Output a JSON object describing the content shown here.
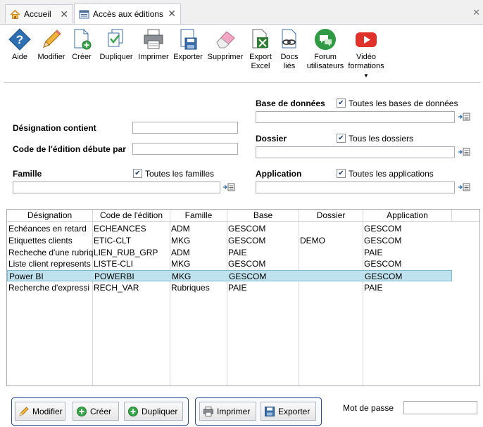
{
  "tabs": [
    {
      "label": "Accueil",
      "icon": "home-icon"
    },
    {
      "label": "Accès aux éditions",
      "icon": "report-icon"
    }
  ],
  "toolbar": {
    "aide": "Aide",
    "modifier": "Modifier",
    "creer": "Créer",
    "dupliquer": "Dupliquer",
    "imprimer": "Imprimer",
    "exporter": "Exporter",
    "supprimer": "Supprimer",
    "export_excel_1": "Export",
    "export_excel_2": "Excel",
    "docs_lies_1": "Docs",
    "docs_lies_2": "liés",
    "forum_1": "Forum",
    "forum_2": "utilisateurs",
    "video_1": "Vidéo",
    "video_2": "formations"
  },
  "filters": {
    "designation_label": "Désignation contient",
    "designation_value": "",
    "code_label": "Code de l'édition débute par",
    "code_value": "",
    "famille_label": "Famille",
    "famille_all": "Toutes les familles",
    "famille_value": "",
    "base_label": "Base de données",
    "base_all": "Toutes les bases de données",
    "base_value": "",
    "dossier_label": "Dossier",
    "dossier_all": "Tous les dossiers",
    "dossier_value": "",
    "application_label": "Application",
    "application_all": "Toutes les applications",
    "application_value": ""
  },
  "grid": {
    "columns": [
      "Désignation",
      "Code de l'édition",
      "Famille",
      "Base",
      "Dossier",
      "Application"
    ],
    "rows": [
      [
        "Echéances en retard",
        "ECHEANCES",
        "ADM",
        "GESCOM",
        "",
        "GESCOM"
      ],
      [
        "Etiquettes clients",
        "ETIC-CLT",
        "MKG",
        "GESCOM",
        "DEMO",
        "GESCOM"
      ],
      [
        "Recheche d'une rubriq",
        "LIEN_RUB_GRP",
        "ADM",
        "PAIE",
        "",
        "PAIE"
      ],
      [
        "Liste client represents",
        "LISTE-CLI",
        "MKG",
        "GESCOM",
        "",
        "GESCOM"
      ],
      [
        "Power BI",
        "POWERBI",
        "MKG",
        "GESCOM",
        "",
        "GESCOM"
      ],
      [
        "Recherche d'expressi",
        "RECH_VAR",
        "Rubriques",
        "PAIE",
        "",
        "PAIE"
      ]
    ],
    "selected_row": 4
  },
  "bottom": {
    "modifier": "Modifier",
    "creer": "Créer",
    "dupliquer": "Dupliquer",
    "imprimer": "Imprimer",
    "exporter": "Exporter",
    "password_label": "Mot de passe",
    "password_value": ""
  },
  "colors": {
    "selection": "#bfe3ee",
    "group_border": "#2b4d8c"
  }
}
